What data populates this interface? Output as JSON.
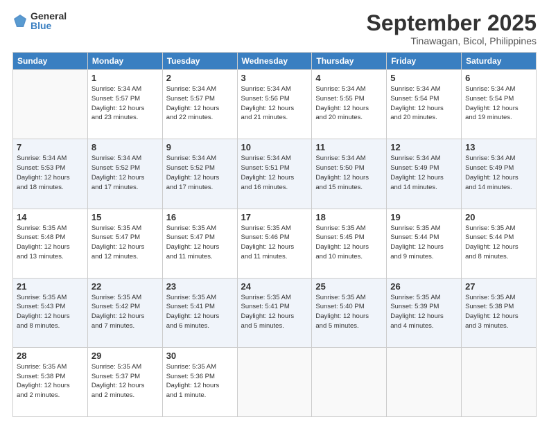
{
  "header": {
    "logo_general": "General",
    "logo_blue": "Blue",
    "month_title": "September 2025",
    "subtitle": "Tinawagan, Bicol, Philippines"
  },
  "days_of_week": [
    "Sunday",
    "Monday",
    "Tuesday",
    "Wednesday",
    "Thursday",
    "Friday",
    "Saturday"
  ],
  "weeks": [
    [
      {
        "day": "",
        "info": ""
      },
      {
        "day": "1",
        "info": "Sunrise: 5:34 AM\nSunset: 5:57 PM\nDaylight: 12 hours\nand 23 minutes."
      },
      {
        "day": "2",
        "info": "Sunrise: 5:34 AM\nSunset: 5:57 PM\nDaylight: 12 hours\nand 22 minutes."
      },
      {
        "day": "3",
        "info": "Sunrise: 5:34 AM\nSunset: 5:56 PM\nDaylight: 12 hours\nand 21 minutes."
      },
      {
        "day": "4",
        "info": "Sunrise: 5:34 AM\nSunset: 5:55 PM\nDaylight: 12 hours\nand 20 minutes."
      },
      {
        "day": "5",
        "info": "Sunrise: 5:34 AM\nSunset: 5:54 PM\nDaylight: 12 hours\nand 20 minutes."
      },
      {
        "day": "6",
        "info": "Sunrise: 5:34 AM\nSunset: 5:54 PM\nDaylight: 12 hours\nand 19 minutes."
      }
    ],
    [
      {
        "day": "7",
        "info": "Sunrise: 5:34 AM\nSunset: 5:53 PM\nDaylight: 12 hours\nand 18 minutes."
      },
      {
        "day": "8",
        "info": "Sunrise: 5:34 AM\nSunset: 5:52 PM\nDaylight: 12 hours\nand 17 minutes."
      },
      {
        "day": "9",
        "info": "Sunrise: 5:34 AM\nSunset: 5:52 PM\nDaylight: 12 hours\nand 17 minutes."
      },
      {
        "day": "10",
        "info": "Sunrise: 5:34 AM\nSunset: 5:51 PM\nDaylight: 12 hours\nand 16 minutes."
      },
      {
        "day": "11",
        "info": "Sunrise: 5:34 AM\nSunset: 5:50 PM\nDaylight: 12 hours\nand 15 minutes."
      },
      {
        "day": "12",
        "info": "Sunrise: 5:34 AM\nSunset: 5:49 PM\nDaylight: 12 hours\nand 14 minutes."
      },
      {
        "day": "13",
        "info": "Sunrise: 5:34 AM\nSunset: 5:49 PM\nDaylight: 12 hours\nand 14 minutes."
      }
    ],
    [
      {
        "day": "14",
        "info": "Sunrise: 5:35 AM\nSunset: 5:48 PM\nDaylight: 12 hours\nand 13 minutes."
      },
      {
        "day": "15",
        "info": "Sunrise: 5:35 AM\nSunset: 5:47 PM\nDaylight: 12 hours\nand 12 minutes."
      },
      {
        "day": "16",
        "info": "Sunrise: 5:35 AM\nSunset: 5:47 PM\nDaylight: 12 hours\nand 11 minutes."
      },
      {
        "day": "17",
        "info": "Sunrise: 5:35 AM\nSunset: 5:46 PM\nDaylight: 12 hours\nand 11 minutes."
      },
      {
        "day": "18",
        "info": "Sunrise: 5:35 AM\nSunset: 5:45 PM\nDaylight: 12 hours\nand 10 minutes."
      },
      {
        "day": "19",
        "info": "Sunrise: 5:35 AM\nSunset: 5:44 PM\nDaylight: 12 hours\nand 9 minutes."
      },
      {
        "day": "20",
        "info": "Sunrise: 5:35 AM\nSunset: 5:44 PM\nDaylight: 12 hours\nand 8 minutes."
      }
    ],
    [
      {
        "day": "21",
        "info": "Sunrise: 5:35 AM\nSunset: 5:43 PM\nDaylight: 12 hours\nand 8 minutes."
      },
      {
        "day": "22",
        "info": "Sunrise: 5:35 AM\nSunset: 5:42 PM\nDaylight: 12 hours\nand 7 minutes."
      },
      {
        "day": "23",
        "info": "Sunrise: 5:35 AM\nSunset: 5:41 PM\nDaylight: 12 hours\nand 6 minutes."
      },
      {
        "day": "24",
        "info": "Sunrise: 5:35 AM\nSunset: 5:41 PM\nDaylight: 12 hours\nand 5 minutes."
      },
      {
        "day": "25",
        "info": "Sunrise: 5:35 AM\nSunset: 5:40 PM\nDaylight: 12 hours\nand 5 minutes."
      },
      {
        "day": "26",
        "info": "Sunrise: 5:35 AM\nSunset: 5:39 PM\nDaylight: 12 hours\nand 4 minutes."
      },
      {
        "day": "27",
        "info": "Sunrise: 5:35 AM\nSunset: 5:38 PM\nDaylight: 12 hours\nand 3 minutes."
      }
    ],
    [
      {
        "day": "28",
        "info": "Sunrise: 5:35 AM\nSunset: 5:38 PM\nDaylight: 12 hours\nand 2 minutes."
      },
      {
        "day": "29",
        "info": "Sunrise: 5:35 AM\nSunset: 5:37 PM\nDaylight: 12 hours\nand 2 minutes."
      },
      {
        "day": "30",
        "info": "Sunrise: 5:35 AM\nSunset: 5:36 PM\nDaylight: 12 hours\nand 1 minute."
      },
      {
        "day": "",
        "info": ""
      },
      {
        "day": "",
        "info": ""
      },
      {
        "day": "",
        "info": ""
      },
      {
        "day": "",
        "info": ""
      }
    ]
  ]
}
